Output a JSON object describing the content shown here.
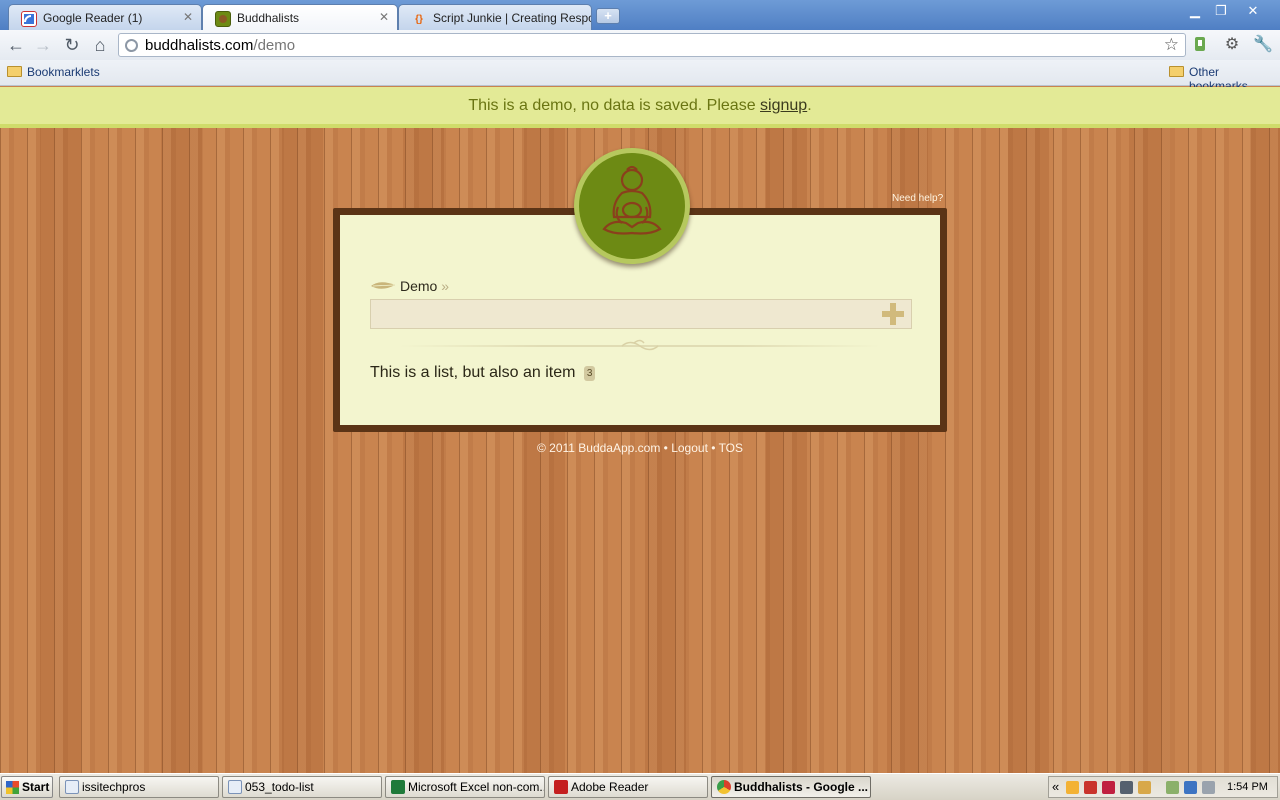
{
  "browser": {
    "tabs": [
      {
        "title": "Google Reader (1)",
        "icon": "google-reader-icon",
        "active": false
      },
      {
        "title": "Buddhalists",
        "icon": "buddha-favicon",
        "active": true
      },
      {
        "title": "Script Junkie | Creating Respo",
        "icon": "script-junkie-icon",
        "active": false
      }
    ],
    "address": {
      "domain": "buddhalists.com",
      "path": "/demo"
    },
    "bookmarks": {
      "left": "Bookmarklets",
      "right": "Other bookmarks"
    }
  },
  "page": {
    "banner": {
      "text": "This is a demo, no data is saved. Please ",
      "link": "signup",
      "suffix": "."
    },
    "need_help": "Need help?",
    "list": {
      "title": "Demo",
      "title_suffix": "»",
      "add_placeholder": "",
      "items": [
        {
          "text": "This is a list, but also an item",
          "count": "3"
        }
      ]
    },
    "footer": "© 2011 BuddaApp.com • Logout • TOS"
  },
  "taskbar": {
    "start": "Start",
    "tasks": [
      {
        "label": "issitechpros",
        "icon": "notepad-icon",
        "active": false
      },
      {
        "label": "053_todo-list",
        "icon": "notepad-icon",
        "active": false
      },
      {
        "label": "Microsoft Excel non-com...",
        "icon": "excel-icon",
        "active": false
      },
      {
        "label": "Adobe Reader",
        "icon": "adobe-reader-icon",
        "active": false
      },
      {
        "label": "Buddhalists - Google ...",
        "icon": "chrome-icon",
        "active": true
      }
    ],
    "tray_expand": "«",
    "clock": "1:54 PM"
  },
  "colors": {
    "banner_bg": "#e3ea96",
    "banner_text": "#6a7512",
    "panel_bg": "#f3f5cf",
    "panel_frame": "#5b3416",
    "logo_green": "#6d8a14",
    "wood": "#c9844f"
  }
}
